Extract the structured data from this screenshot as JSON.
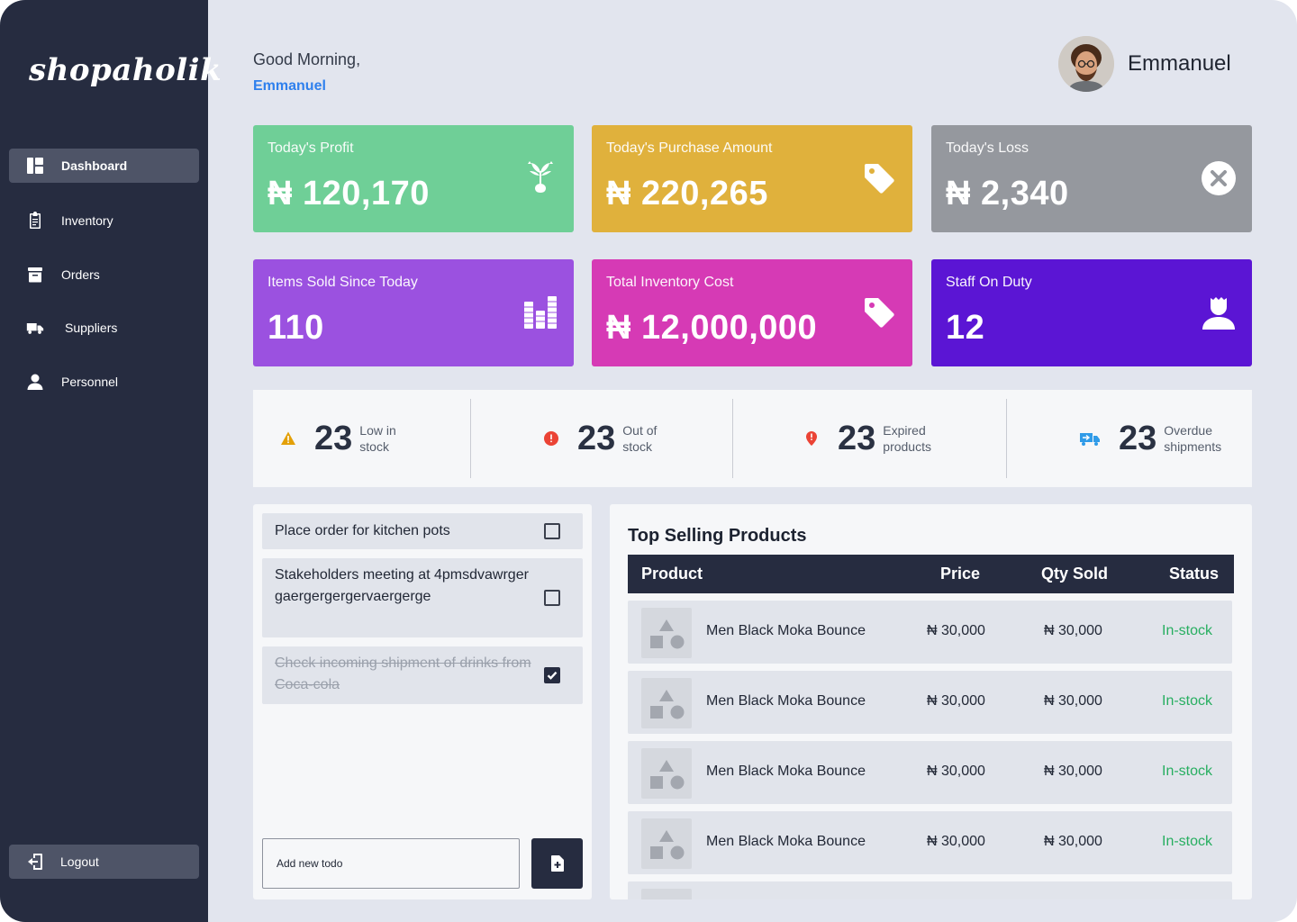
{
  "brand": "shopaholik",
  "sidebar": {
    "items": [
      {
        "label": "Dashboard",
        "icon": "dashboard-icon"
      },
      {
        "label": "Inventory",
        "icon": "clipboard-icon"
      },
      {
        "label": "Orders",
        "icon": "archive-box-icon"
      },
      {
        "label": "Suppliers",
        "icon": "delivery-truck-icon"
      },
      {
        "label": "Personnel",
        "icon": "person-icon"
      }
    ],
    "logout": "Logout"
  },
  "header": {
    "greeting": "Good Morning,",
    "greeting_name": "Emmanuel",
    "user_name": "Emmanuel"
  },
  "cards": [
    {
      "title": "Today's Profit",
      "value": "₦ 120,170",
      "color": "#6fcf97",
      "icon": "money-plant-icon"
    },
    {
      "title": "Today's Purchase Amount",
      "value": "₦ 220,265",
      "color": "#e0b13c",
      "icon": "price-tag-icon"
    },
    {
      "title": "Today's Loss",
      "value": "₦ 2,340",
      "color": "#95989e",
      "icon": "x-circle-icon"
    },
    {
      "title": "Items Sold Since Today",
      "value": "110",
      "color": "#9b51e0",
      "icon": "bar-chart-icon"
    },
    {
      "title": "Total Inventory Cost",
      "value": "₦ 12,000,000",
      "color": "#d63ab5",
      "icon": "price-tag-icon"
    },
    {
      "title": "Staff On Duty",
      "value": "12",
      "color": "#5b15d4",
      "icon": "staff-icon"
    }
  ],
  "alerts": [
    {
      "count": "23",
      "label": "Low in stock",
      "icon": "warning-triangle-icon",
      "color": "#e3a008"
    },
    {
      "count": "23",
      "label": "Out of stock",
      "icon": "alert-circle-icon",
      "color": "#eb4335"
    },
    {
      "count": "23",
      "label": "Expired products",
      "icon": "map-pin-alert-icon",
      "color": "#eb4335"
    },
    {
      "count": "23",
      "label": "Overdue shipments",
      "icon": "shipping-truck-icon",
      "color": "#2f9be8"
    }
  ],
  "todos": {
    "items": [
      {
        "text": "Place order for kitchen pots",
        "done": false
      },
      {
        "text": "Stakeholders meeting at 4pmsdvawrgergaergergergervaergerge",
        "done": false
      },
      {
        "text": "Check incoming shipment of drinks from Coca-cola",
        "done": true
      }
    ],
    "placeholder": "Add new todo"
  },
  "products": {
    "title": "Top Selling Products",
    "columns": [
      "Product",
      "Price",
      "Qty Sold",
      "Status"
    ],
    "rows": [
      {
        "name": "Men Black Moka Bounce",
        "price": "₦ 30,000",
        "qty": "₦ 30,000",
        "status": "In-stock"
      },
      {
        "name": "Men Black Moka Bounce",
        "price": "₦ 30,000",
        "qty": "₦ 30,000",
        "status": "In-stock"
      },
      {
        "name": "Men Black Moka Bounce",
        "price": "₦ 30,000",
        "qty": "₦ 30,000",
        "status": "In-stock"
      },
      {
        "name": "Men Black Moka Bounce",
        "price": "₦ 30,000",
        "qty": "₦ 30,000",
        "status": "In-stock"
      }
    ]
  }
}
